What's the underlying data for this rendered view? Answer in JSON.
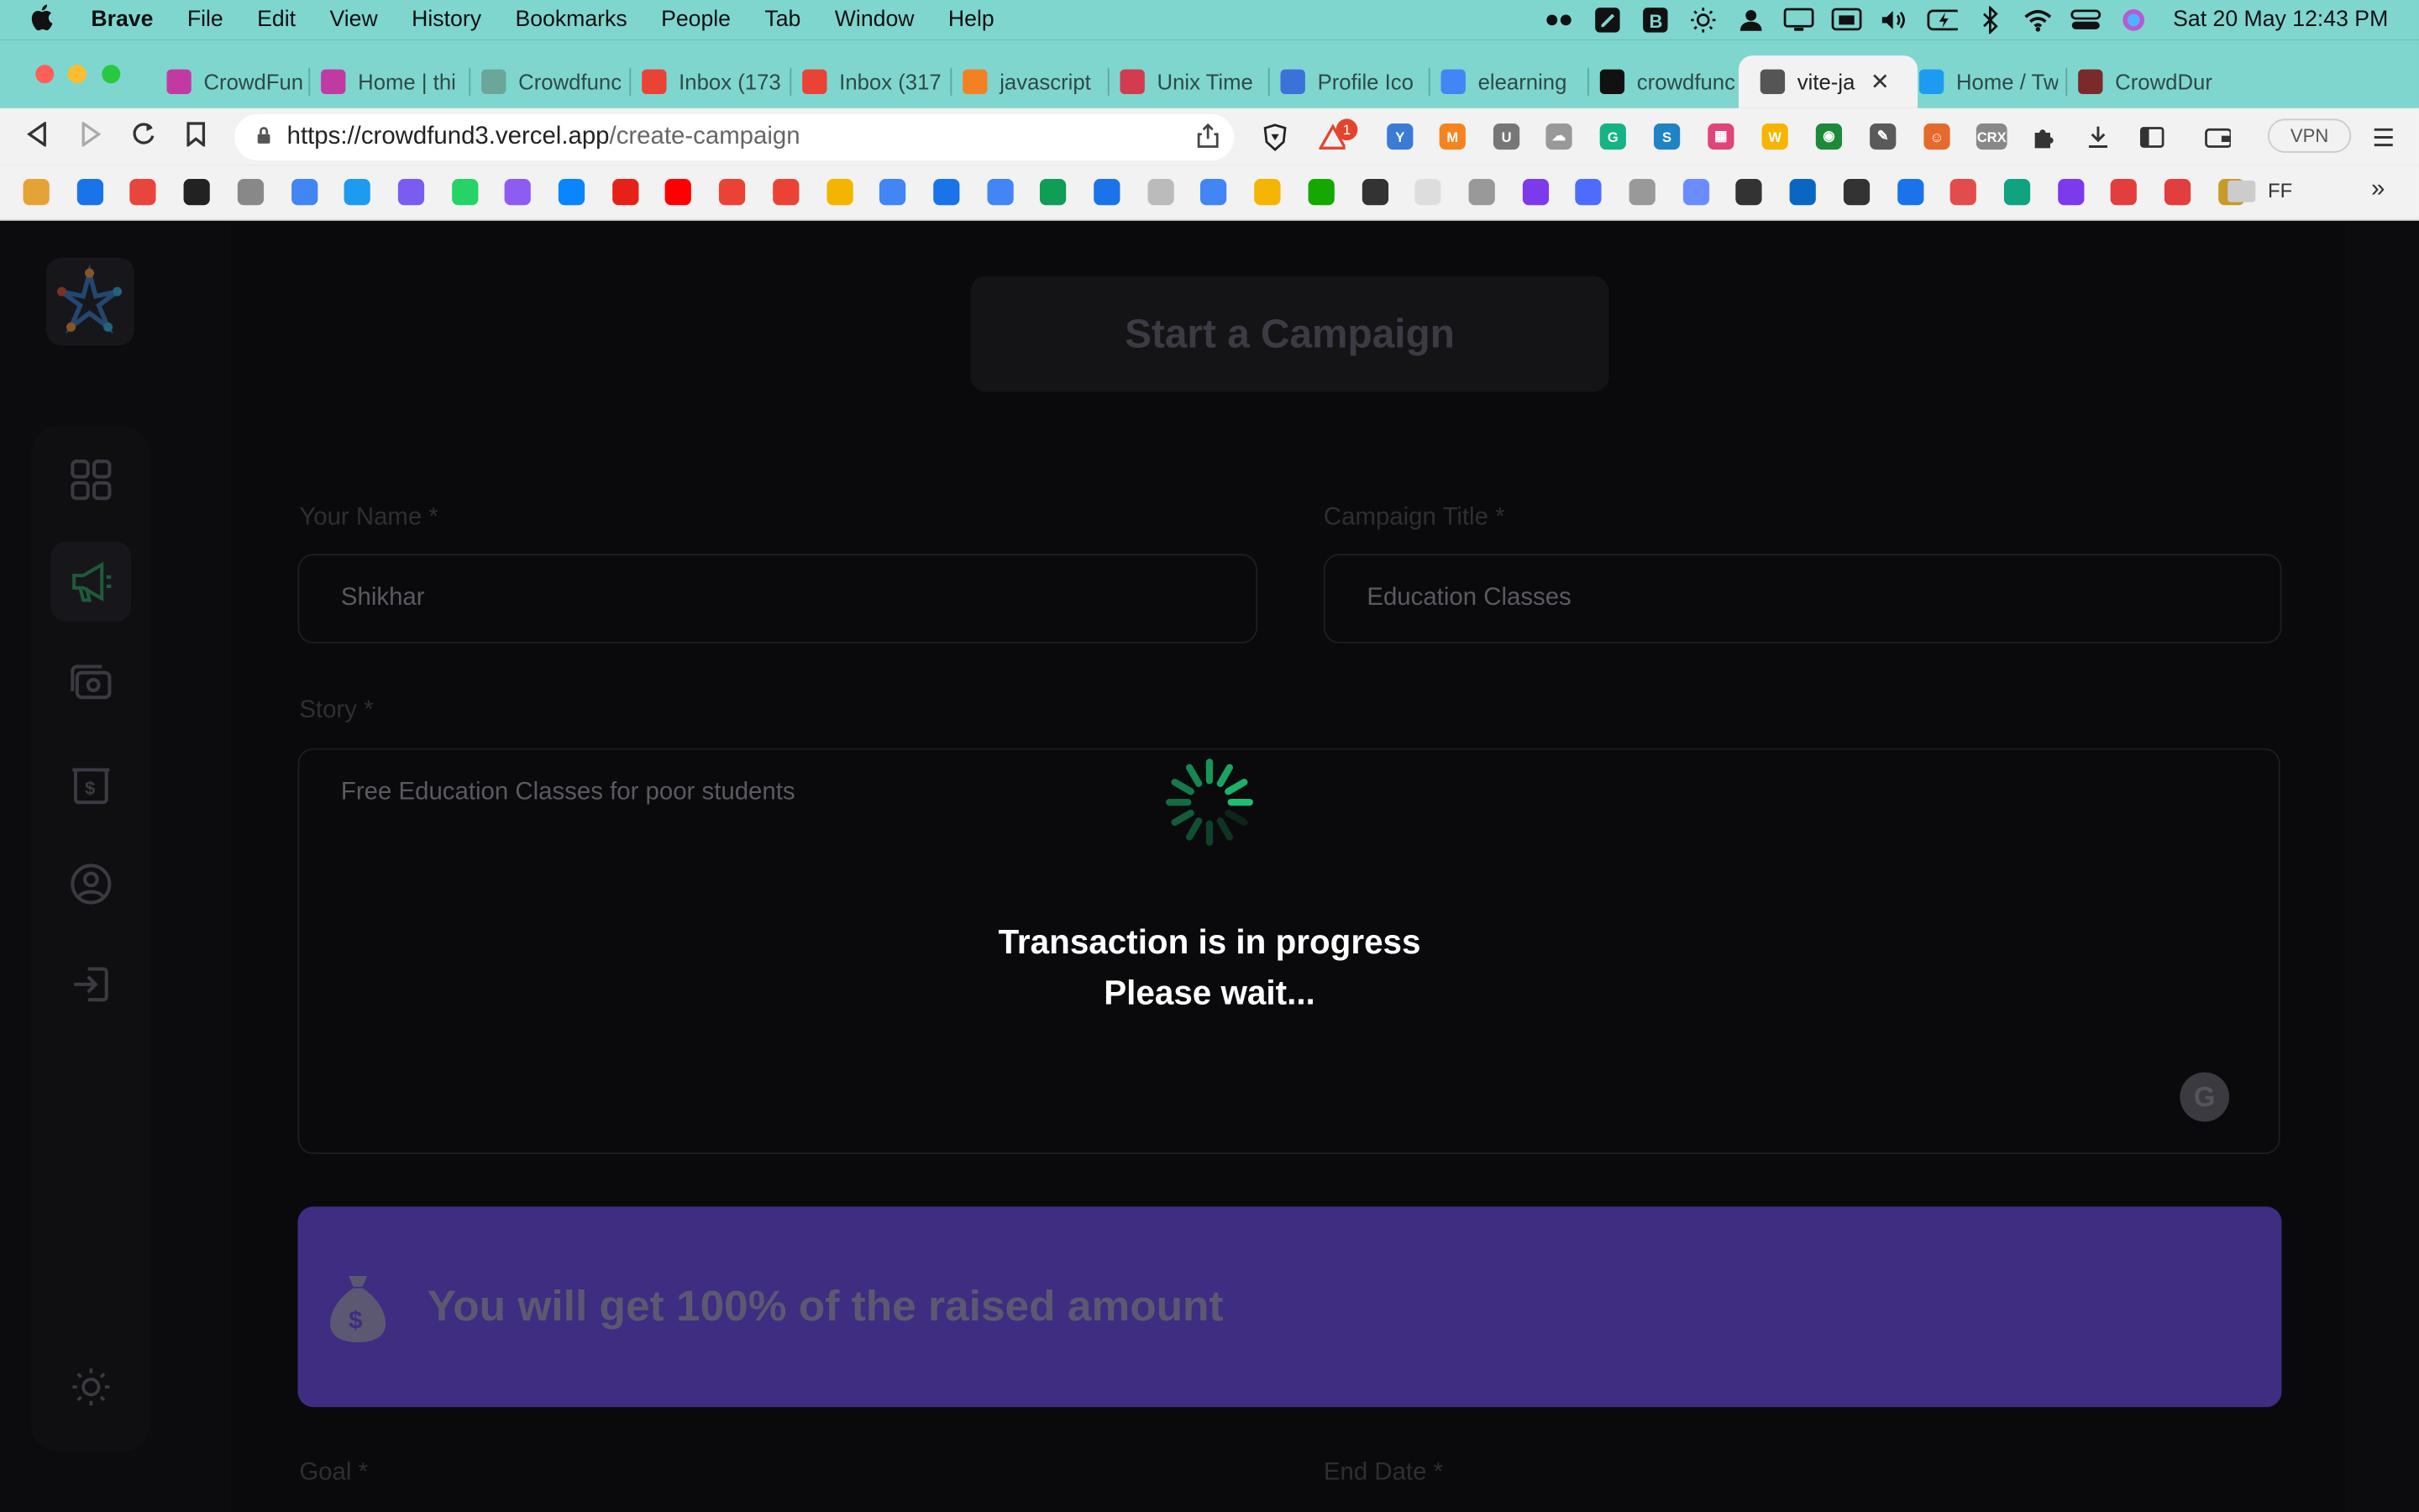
{
  "menubar": {
    "app": "Brave",
    "items": [
      "File",
      "Edit",
      "View",
      "History",
      "Bookmarks",
      "People",
      "Tab",
      "Window",
      "Help"
    ],
    "clock": "Sat 20 May  12:43 PM"
  },
  "tabs": [
    {
      "label": "CrowdFun",
      "fav": "#c13aa4"
    },
    {
      "label": "Home | thi",
      "fav": "#c13aa4"
    },
    {
      "label": "Crowdfunc",
      "fav": "#6aa79a"
    },
    {
      "label": "Inbox (173",
      "fav": "#ea4335"
    },
    {
      "label": "Inbox (317",
      "fav": "#ea4335"
    },
    {
      "label": "javascript",
      "fav": "#f48024"
    },
    {
      "label": "Unix Time",
      "fav": "#d23c4e"
    },
    {
      "label": "Profile Ico",
      "fav": "#3a72d8"
    },
    {
      "label": "elearning",
      "fav": "#4285f4"
    },
    {
      "label": "crowdfunc",
      "fav": "#111111"
    },
    {
      "label": "vite-ja",
      "fav": "#555555"
    },
    {
      "label": "Home / Tw",
      "fav": "#1d9bf0"
    },
    {
      "label": "CrowdDur",
      "fav": "#7a2a2a"
    }
  ],
  "toolbar": {
    "url_host": "https://crowdfund3.vercel.app",
    "url_path": "/create-campaign",
    "vpn": "VPN",
    "brave_badge": "1"
  },
  "bookmarks": {
    "folder": "FF"
  },
  "page": {
    "title": "Start a Campaign",
    "name_label": "Your Name *",
    "name_value": "Shikhar",
    "campaign_label": "Campaign Title *",
    "campaign_value": "Education Classes",
    "story_label": "Story *",
    "story_value": "Free Education Classes for poor students",
    "banner_text": "You will get 100% of the raised amount",
    "goal_label": "Goal *",
    "enddate_label": "End Date *"
  },
  "loader": {
    "line1": "Transaction is in progress",
    "line2": "Please wait..."
  },
  "colors": {
    "accent": "#1dc071",
    "banner": "#3e2d80",
    "menubar": "#7fd6cf"
  }
}
